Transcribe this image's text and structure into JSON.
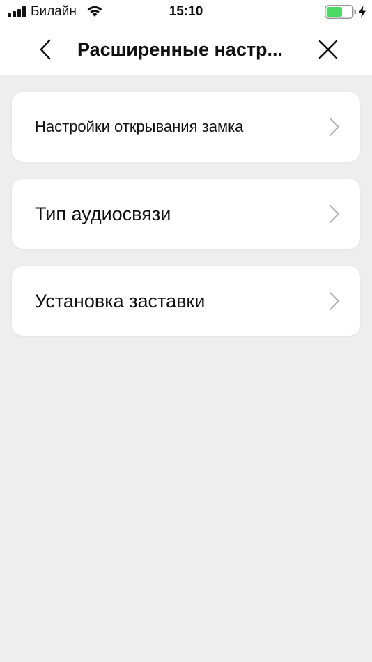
{
  "status_bar": {
    "carrier": "Билайн",
    "time": "15:10",
    "battery_color": "#4cd964"
  },
  "nav": {
    "title": "Расширенные настр...",
    "back_icon": "chevron-left-icon",
    "close_icon": "close-icon"
  },
  "menu": {
    "items": [
      {
        "label": "Настройки открывания замка"
      },
      {
        "label": "Тип аудиосвязи"
      },
      {
        "label": "Установка заставки"
      }
    ]
  },
  "colors": {
    "background": "#eeeeee",
    "card": "#ffffff",
    "chevron": "#b5b5b5"
  }
}
